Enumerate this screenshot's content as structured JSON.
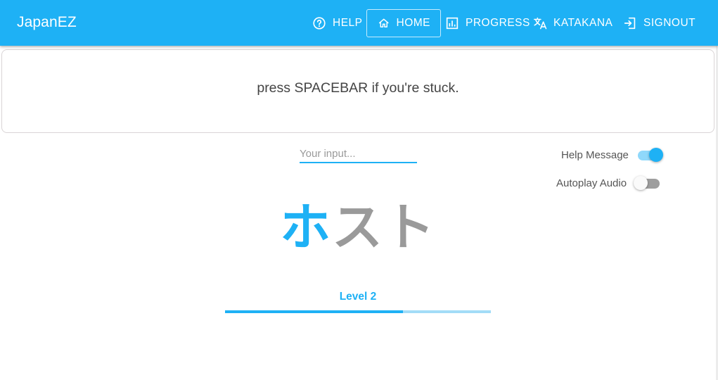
{
  "app": {
    "title": "JapanEZ"
  },
  "nav": {
    "help": {
      "label": "HELP",
      "icon": "help-circle-icon"
    },
    "home": {
      "label": "HOME",
      "icon": "home-icon"
    },
    "progress": {
      "label": "PROGRESS",
      "icon": "chart-icon"
    },
    "katakana": {
      "label": "KATAKANA",
      "icon": "translate-icon"
    },
    "signout": {
      "label": "SIGNOUT",
      "icon": "signout-icon"
    }
  },
  "hint": {
    "text": "press SPACEBAR if you're stuck."
  },
  "input": {
    "placeholder": "Your input...",
    "value": ""
  },
  "toggles": {
    "help_message": {
      "label": "Help Message",
      "on": true
    },
    "autoplay_audio": {
      "label": "Autoplay Audio",
      "on": false
    }
  },
  "word": {
    "completed": "ホ",
    "remaining": "スト"
  },
  "level": {
    "label": "Level 2",
    "progress": 0.67
  },
  "colors": {
    "primary": "#1eb1f5",
    "primary_light": "#a3dcf7",
    "pending": "#9a9a9a"
  }
}
